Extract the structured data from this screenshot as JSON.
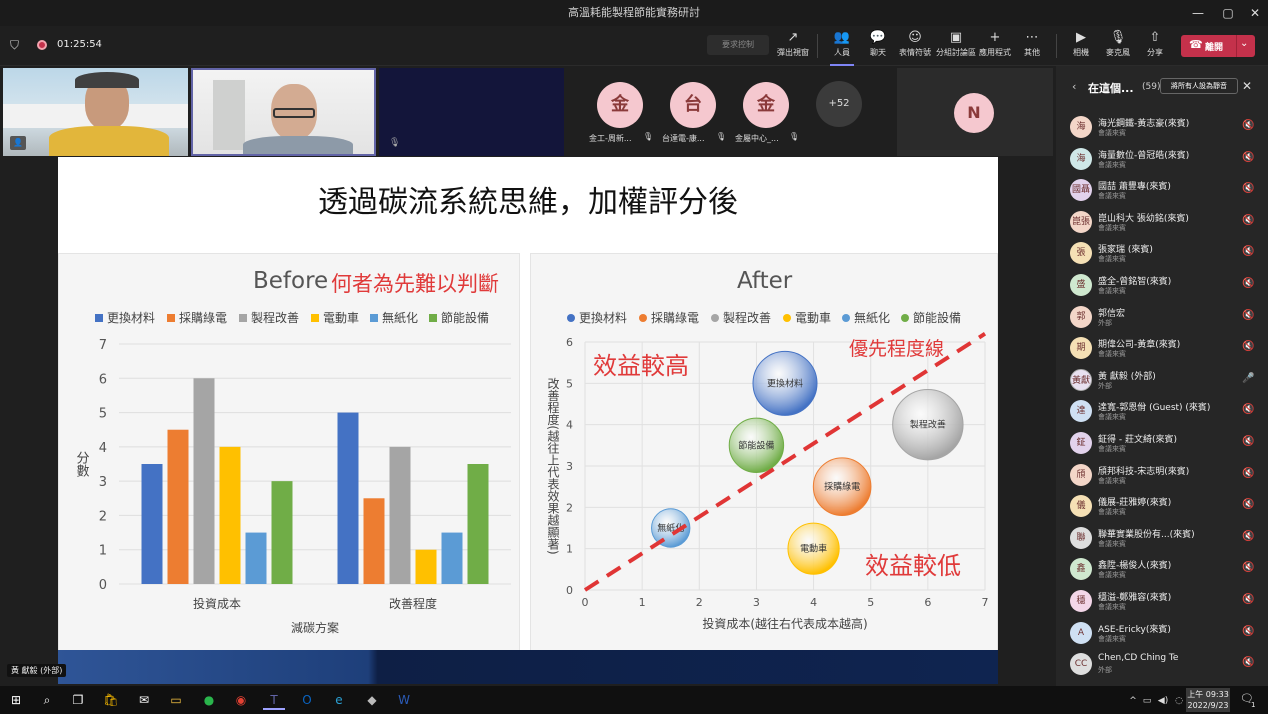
{
  "window": {
    "title": "高溫耗能製程節能實務研討",
    "minimize": "—",
    "maximize": "▢",
    "close": "✕"
  },
  "toolbar": {
    "timer": "01:25:54",
    "request_control": "要求控制",
    "buttons": [
      {
        "label": "彈出視窗",
        "icon": "↗"
      },
      {
        "label": "人員",
        "icon": "👥"
      },
      {
        "label": "聊天",
        "icon": "💬"
      },
      {
        "label": "表情符號",
        "icon": "☺"
      },
      {
        "label": "分組討論區",
        "icon": "▣"
      },
      {
        "label": "應用程式",
        "icon": "+"
      },
      {
        "label": "其他",
        "icon": "⋯"
      },
      {
        "label": "相機",
        "icon": "▶"
      },
      {
        "label": "麥克風",
        "icon": "🎙"
      },
      {
        "label": "分享",
        "icon": "⇧"
      }
    ],
    "leave": "離開"
  },
  "gallery": {
    "people": [
      {
        "initial": "金",
        "name": "金工-周新..."
      },
      {
        "initial": "台",
        "name": "台達電-康..."
      },
      {
        "initial": "金",
        "name": "金屬中心_..."
      }
    ],
    "more": "+52",
    "last_initial": "N",
    "self_label": "黃 獻毅 (外部)"
  },
  "slide": {
    "title": "透過碳流系統思維，加權評分後",
    "before_title": "Before",
    "before_note": "何者為先難以判斷",
    "after_title": "After",
    "high_label": "效益較高",
    "low_label": "效益較低",
    "priority_label": "優先程度線"
  },
  "chart_data": [
    {
      "type": "bar",
      "title": "Before",
      "categories": [
        "投資成本",
        "改善程度"
      ],
      "series": [
        {
          "name": "更換材料",
          "values": [
            3.5,
            5
          ],
          "color": "#4472c4"
        },
        {
          "name": "採購綠電",
          "values": [
            4.5,
            2.5
          ],
          "color": "#ed7d31"
        },
        {
          "name": "製程改善",
          "values": [
            6,
            4
          ],
          "color": "#a5a5a5"
        },
        {
          "name": "電動車",
          "values": [
            4,
            1
          ],
          "color": "#ffc000"
        },
        {
          "name": "無紙化",
          "values": [
            1.5,
            1.5
          ],
          "color": "#5b9bd5"
        },
        {
          "name": "節能設備",
          "values": [
            3,
            3.5
          ],
          "color": "#70ad47"
        }
      ],
      "xlabel": "減碳方案",
      "ylabel": "分數",
      "ylim": [
        0,
        7
      ],
      "yticks": [
        "0",
        "1",
        "2",
        "3",
        "4",
        "5",
        "6",
        "7"
      ],
      "grid": true,
      "legend": "top"
    },
    {
      "type": "scatter",
      "title": "After",
      "series": [
        {
          "name": "更換材料",
          "x": 3.5,
          "y": 5,
          "size": 1,
          "color": "#4472c4"
        },
        {
          "name": "採購綠電",
          "x": 4.5,
          "y": 2.5,
          "size": 0.9,
          "color": "#ed7d31"
        },
        {
          "name": "製程改善",
          "x": 6,
          "y": 4,
          "size": 1.1,
          "color": "#a5a5a5"
        },
        {
          "name": "電動車",
          "x": 4,
          "y": 1,
          "size": 0.8,
          "color": "#ffc000"
        },
        {
          "name": "無紙化",
          "x": 1.5,
          "y": 1.5,
          "size": 0.6,
          "color": "#5b9bd5"
        },
        {
          "name": "節能設備",
          "x": 3,
          "y": 3.5,
          "size": 0.85,
          "color": "#70ad47"
        }
      ],
      "xlabel": "投資成本(越往右代表成本越高)",
      "ylabel": "改善程度(越往上代表效果越顯著)",
      "xlim": [
        0,
        7
      ],
      "ylim": [
        0,
        6
      ],
      "xticks": [
        "0",
        "1",
        "2",
        "3",
        "4",
        "5",
        "6",
        "7"
      ],
      "yticks": [
        "0",
        "1",
        "2",
        "3",
        "4",
        "5",
        "6"
      ],
      "trendline": {
        "from": [
          0,
          0
        ],
        "to": [
          7,
          6.2
        ],
        "style": "dashed",
        "color": "#e03535"
      },
      "grid": true,
      "legend": "top"
    }
  ],
  "roster": {
    "header": "在這個...",
    "count": "(59)",
    "mute_all": "將所有人設為靜音",
    "members": [
      {
        "initial": "海",
        "name": "海光鋼鐵-黃志豪(來賓)",
        "role": "會議來賓",
        "color": "#f3d6c8"
      },
      {
        "initial": "海",
        "name": "海量數位-曾冠皓(來賓)",
        "role": "會議來賓",
        "color": "#cfe8e8"
      },
      {
        "initial": "國聶",
        "name": "國喆 蕭豐專(來賓)",
        "role": "會議來賓",
        "color": "#e2d2ec"
      },
      {
        "initial": "崑張",
        "name": "崑山科大 張幼銘(來賓)",
        "role": "會議來賓",
        "color": "#f3d6c8"
      },
      {
        "initial": "張",
        "name": "張家瑞 (來賓)",
        "role": "會議來賓",
        "color": "#f5e0b5"
      },
      {
        "initial": "盛",
        "name": "盛全-曾銘智(來賓)",
        "role": "會議來賓",
        "color": "#cfe8cf"
      },
      {
        "initial": "郭",
        "name": "郭信宏",
        "role": "外部",
        "color": "#f3d6c8"
      },
      {
        "initial": "期",
        "name": "期偉公司-黃章(來賓)",
        "role": "會議來賓",
        "color": "#f5e0b5"
      },
      {
        "initial": "黃獻",
        "name": "黃 獻毅 (外部)",
        "role": "外部",
        "color": "#e8e0f0"
      },
      {
        "initial": "達",
        "name": "達寬-郭恩佾 (Guest) (來賓)",
        "role": "會議來賓",
        "color": "#cfe0f3"
      },
      {
        "initial": "鉦",
        "name": "鉦得 - 莊文綺(來賓)",
        "role": "會議來賓",
        "color": "#e2d2ec"
      },
      {
        "initial": "頎",
        "name": "頎邦科技-宋志明(來賓)",
        "role": "會議來賓",
        "color": "#f3d6c8"
      },
      {
        "initial": "儀",
        "name": "儀展-莊雅婷(來賓)",
        "role": "會議來賓",
        "color": "#f5e0b5"
      },
      {
        "initial": "聯",
        "name": "聯華實業股份有...(來賓)",
        "role": "會議來賓",
        "color": "#dedede"
      },
      {
        "initial": "鑫",
        "name": "鑫陞-楊俊人(來賓)",
        "role": "會議來賓",
        "color": "#cfe8cf"
      },
      {
        "initial": "穩",
        "name": "穩溢-鄭雅容(來賓)",
        "role": "會議來賓",
        "color": "#f3d6e8"
      },
      {
        "initial": "A",
        "name": "ASE-Ericky(來賓)",
        "role": "會議來賓",
        "color": "#cfe0f3"
      },
      {
        "initial": "CC",
        "name": "Chen,CD Ching Te",
        "role": "外部",
        "color": "#dedede"
      }
    ]
  },
  "taskbar": {
    "time": "上午 09:33",
    "date": "2022/9/23",
    "notif": "1"
  }
}
